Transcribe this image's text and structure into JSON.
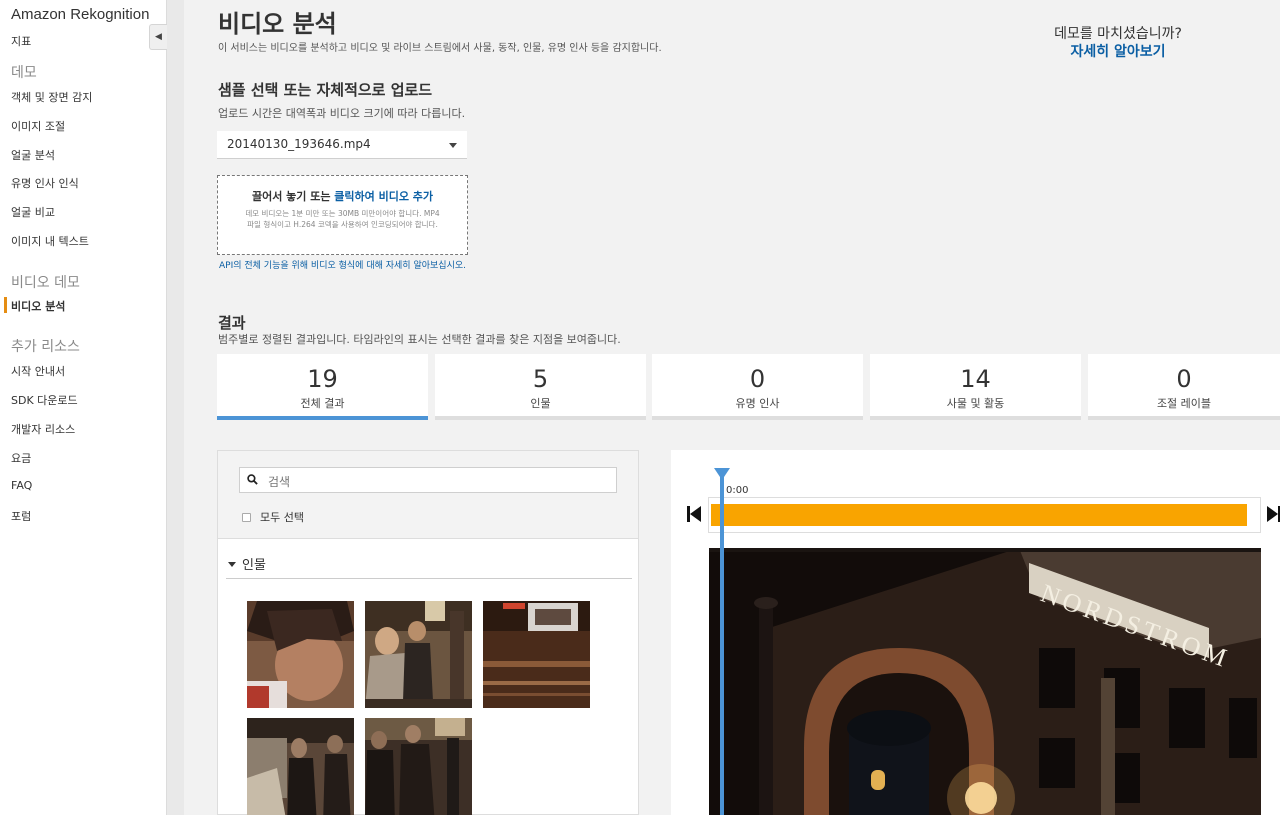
{
  "sidebar": {
    "brand": "Amazon Rekognition",
    "items": [
      {
        "label": "지표"
      },
      {
        "label": "데모",
        "section": true
      },
      {
        "label": "객체 및 장면 감지"
      },
      {
        "label": "이미지 조절"
      },
      {
        "label": "얼굴 분석"
      },
      {
        "label": "유명 인사 인식"
      },
      {
        "label": "얼굴 비교"
      },
      {
        "label": "이미지 내 텍스트"
      },
      {
        "label": "비디오 데모",
        "section": true
      },
      {
        "label": "비디오 분석",
        "active": true
      },
      {
        "label": "추가 리소스",
        "section": true
      },
      {
        "label": "시작 안내서"
      },
      {
        "label": "SDK 다운로드"
      },
      {
        "label": "개발자 리소스"
      },
      {
        "label": "요금"
      },
      {
        "label": "FAQ"
      },
      {
        "label": "포럼"
      }
    ],
    "collapse_icon": "caret-left-icon",
    "accent_color": "#e58d13"
  },
  "header": {
    "title": "비디오 분석",
    "description": "이 서비스는 비디오를 분석하고 비디오 및 라이브 스트림에서 사물, 동작, 인물, 유명 인사 등을 감지합니다.",
    "finish_question": "데모를 마치셨습니까?",
    "learn_more_link": "자세히 알아보기",
    "link_color": "#0b5fa4"
  },
  "sample": {
    "title": "샘플 선택 또는 자체적으로 업로드",
    "description": "업로드 시간은 대역폭과 비디오 크기에 따라 다릅니다.",
    "selected_file": "20140130_193646.mp4",
    "dropzone": {
      "title_prefix": "끌어서 놓기 또는 ",
      "title_link": "클릭하여 비디오 추가",
      "body": "데모 비디오는 1분 미만 또는 30MB 미만이어야 합니다. MP4 파일 형식이고 H.264 코덱을 사용하여 인코딩되어야 합니다."
    },
    "api_note": "API의 전체 기능을 위해 비디오 형식에 대해 자세히 알아보십시오."
  },
  "results": {
    "title": "결과",
    "description": "범주별로 정렬된 결과입니다. 타임라인의 표시는 선택한 결과를 찾은 지점을 보여줍니다.",
    "tabs": [
      {
        "count": "19",
        "label": "전체 결과",
        "active": true
      },
      {
        "count": "5",
        "label": "인물"
      },
      {
        "count": "0",
        "label": "유명 인사"
      },
      {
        "count": "14",
        "label": "사물 및 활동"
      },
      {
        "count": "0",
        "label": "조절 레이블"
      }
    ],
    "active_tab_color": "#4c94d6"
  },
  "panel": {
    "search_placeholder": "검색",
    "search_icon": "search-icon",
    "select_all": "모두 선택",
    "people_section": "인물",
    "people_thumbnails": [
      "person-thumb-1",
      "person-thumb-2",
      "person-thumb-3",
      "person-thumb-4",
      "person-thumb-5"
    ]
  },
  "video": {
    "time_label": "0:00",
    "timeline_color": "#f9a400",
    "playhead_color": "#4c94d6",
    "skip_prev_icon": "skip-back-icon",
    "skip_next_icon": "skip-forward-icon",
    "sign_text": "NORDSTROM"
  }
}
